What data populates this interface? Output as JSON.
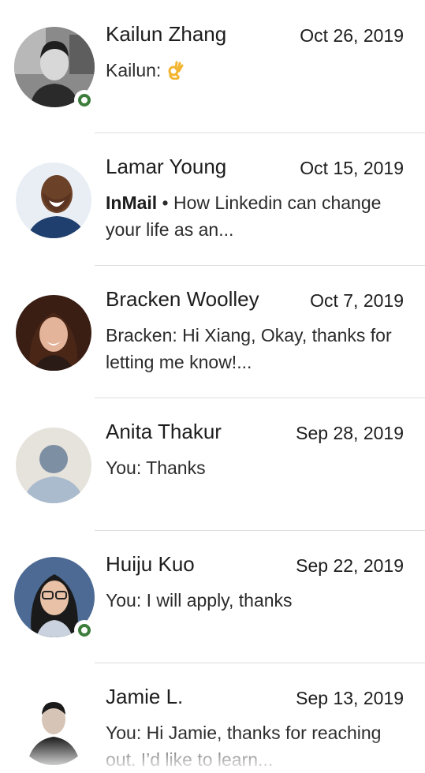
{
  "conversations": [
    {
      "name": "Kailun Zhang",
      "date": "Oct 26, 2019",
      "preview_prefix": "",
      "preview": "Kailun: ",
      "emoji": "ok-hand-emoji",
      "online": true,
      "avatar": "photo"
    },
    {
      "name": "Lamar Young",
      "date": "Oct 15, 2019",
      "preview_prefix": "InMail",
      "preview_sep": " • ",
      "preview": "How Linkedin can change your life as an...",
      "online": false,
      "avatar": "photo"
    },
    {
      "name": "Bracken Woolley",
      "date": "Oct 7, 2019",
      "preview_prefix": "",
      "preview": "Bracken: Hi Xiang, Okay, thanks for letting me know!...",
      "online": false,
      "avatar": "photo"
    },
    {
      "name": "Anita Thakur",
      "date": "Sep 28, 2019",
      "preview_prefix": "",
      "preview": "You: Thanks",
      "online": false,
      "avatar": "placeholder"
    },
    {
      "name": "Huiju Kuo",
      "date": "Sep 22, 2019",
      "preview_prefix": "",
      "preview": "You: I will apply, thanks",
      "online": true,
      "avatar": "photo"
    },
    {
      "name": "Jamie L.",
      "date": "Sep 13, 2019",
      "preview_prefix": "",
      "preview": "You: Hi Jamie, thanks for reaching out. I’d like to learn...",
      "online": false,
      "avatar": "photo"
    }
  ],
  "colors": {
    "online": "#3d7d3c",
    "divider": "#dedede",
    "text": "#1d1d1d"
  }
}
